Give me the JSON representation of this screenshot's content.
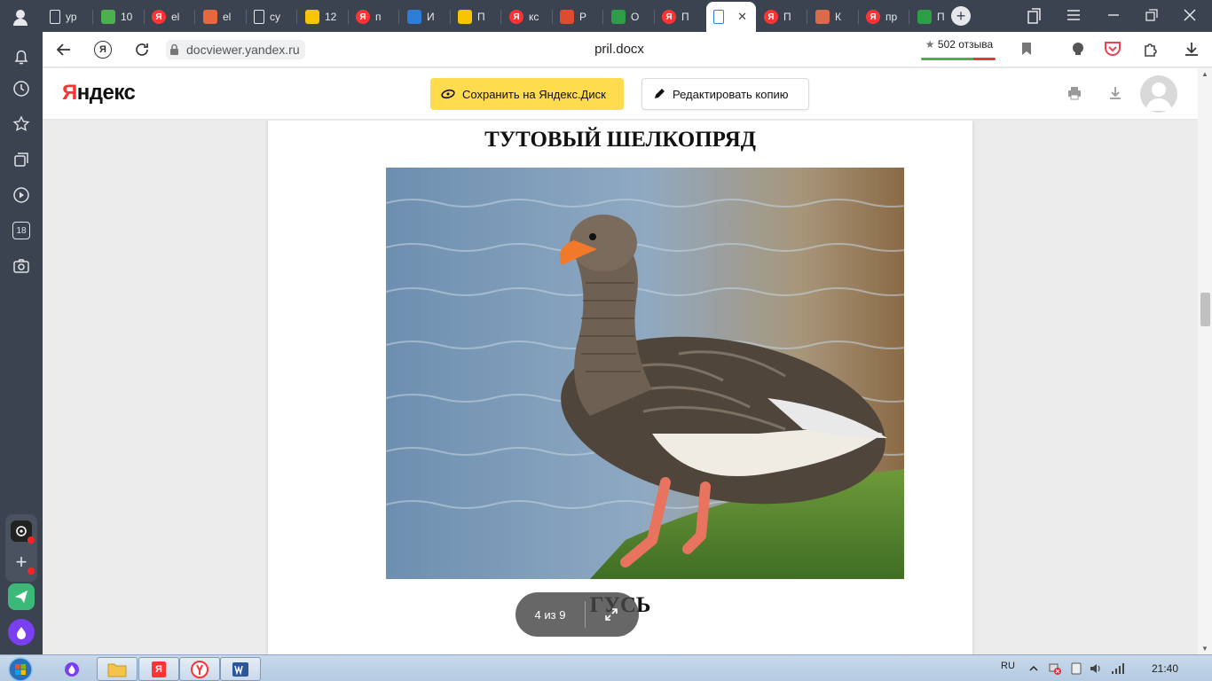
{
  "browser": {
    "tabs": [
      {
        "label": "ур",
        "favicon": "doc-icon",
        "color": "#3b4350"
      },
      {
        "label": "10",
        "favicon": "green-book-icon",
        "color": "#4caf50"
      },
      {
        "label": "el",
        "favicon": "yandex-icon",
        "color": "#f33"
      },
      {
        "label": "el",
        "favicon": "orange-logo-icon",
        "color": "#e8673c"
      },
      {
        "label": "су",
        "favicon": "doc-icon",
        "color": "#3b4350"
      },
      {
        "label": "12",
        "favicon": "mail-icon",
        "color": "#f7c600"
      },
      {
        "label": "п",
        "favicon": "yandex-icon",
        "color": "#f33"
      },
      {
        "label": "И",
        "favicon": "book-icon",
        "color": "#2e7dd7"
      },
      {
        "label": "П",
        "favicon": "info-icon",
        "color": "#f7c600"
      },
      {
        "label": "кс",
        "favicon": "yandex-icon",
        "color": "#f33"
      },
      {
        "label": "Р",
        "favicon": "red-icon",
        "color": "#e04a2f"
      },
      {
        "label": "О",
        "favicon": "green-icon",
        "color": "#2e9d48"
      },
      {
        "label": "П",
        "favicon": "yandex-icon",
        "color": "#f33"
      },
      {
        "label": "",
        "favicon": "docviewer-icon",
        "color": "#2e7dd7",
        "active": true
      },
      {
        "label": "П",
        "favicon": "yandex-icon",
        "color": "#f33"
      },
      {
        "label": "К",
        "favicon": "avatar-icon",
        "color": "#d96a4a"
      },
      {
        "label": "пр",
        "favicon": "yandex-icon",
        "color": "#f33"
      },
      {
        "label": "П",
        "favicon": "check-icon",
        "color": "#2e9d48"
      }
    ],
    "url": "docviewer.yandex.ru",
    "page_title": "pril.docx",
    "reviews_label": "502 отзыва"
  },
  "sidebar": {
    "badge_count": "18"
  },
  "docviewer": {
    "logo_first": "Я",
    "logo_rest": "ндекс",
    "save_button": "Сохранить на Яндекс.Диск",
    "edit_button": "Редактировать копию"
  },
  "document": {
    "heading": "ТУТОВЫЙ ШЕЛКОПРЯД",
    "image_subject": "goose",
    "caption": "ГУСЬ"
  },
  "pager": {
    "label": "4 из 9"
  },
  "taskbar": {
    "language": "RU",
    "clock": "21:40"
  },
  "colors": {
    "chrome_dark": "#3b4350",
    "save_yellow": "#ffdb4d",
    "yandex_red": "#ff3333"
  }
}
